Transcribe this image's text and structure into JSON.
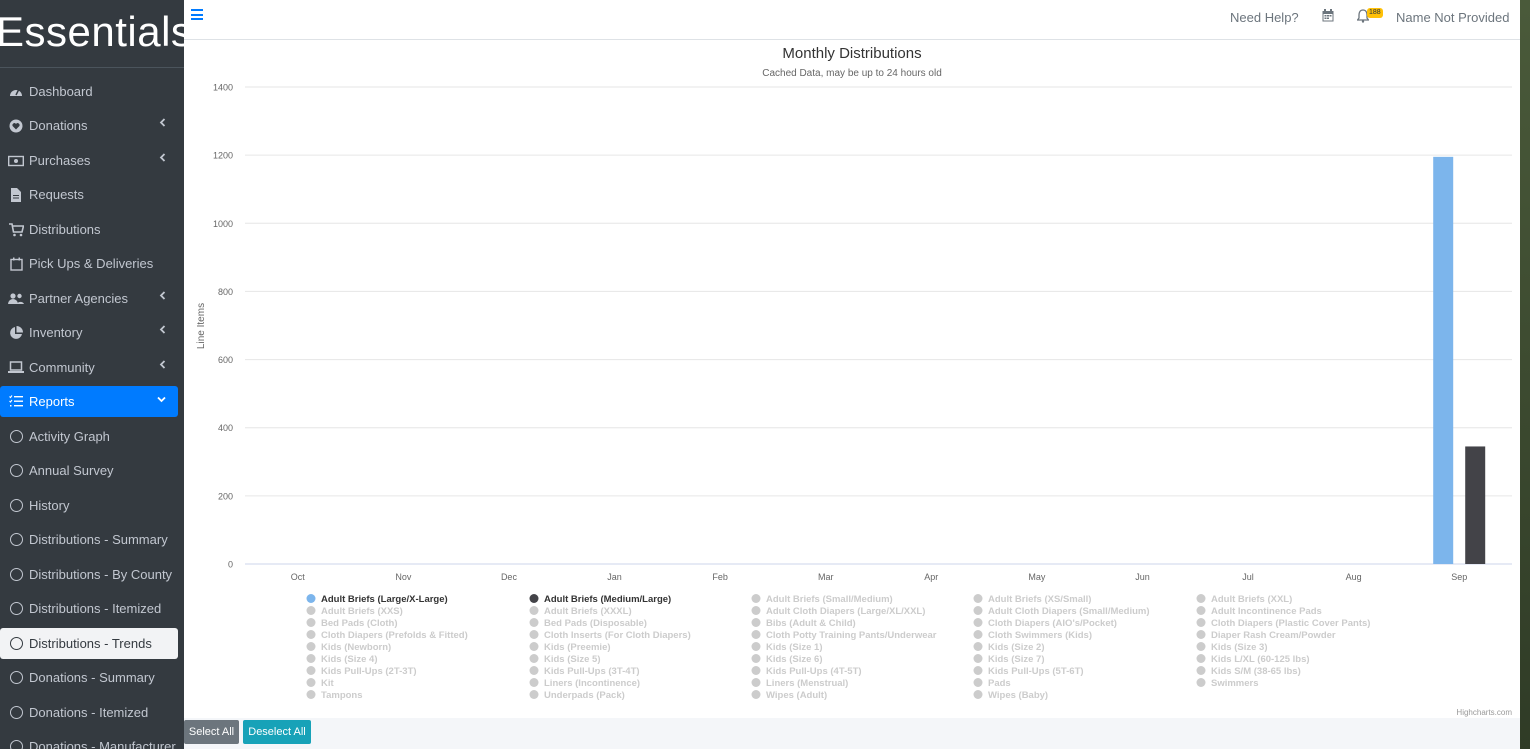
{
  "brand": "Essentials",
  "sidebar": {
    "items": [
      {
        "label": "Dashboard",
        "icon": "dashboard-icon",
        "chevron": false
      },
      {
        "label": "Donations",
        "icon": "heart-icon",
        "chevron": true
      },
      {
        "label": "Purchases",
        "icon": "money-icon",
        "chevron": true
      },
      {
        "label": "Requests",
        "icon": "file-icon",
        "chevron": false
      },
      {
        "label": "Distributions",
        "icon": "cart-icon",
        "chevron": false
      },
      {
        "label": "Pick Ups & Deliveries",
        "icon": "calendar-icon",
        "chevron": false
      },
      {
        "label": "Partner Agencies",
        "icon": "users-icon",
        "chevron": true
      },
      {
        "label": "Inventory",
        "icon": "pie-icon",
        "chevron": true
      },
      {
        "label": "Community",
        "icon": "laptop-icon",
        "chevron": true
      },
      {
        "label": "Reports",
        "icon": "list-icon",
        "chevron": true,
        "active": true
      },
      {
        "label": "Activity Graph",
        "icon": "circle-icon"
      },
      {
        "label": "Annual Survey",
        "icon": "circle-icon"
      },
      {
        "label": "History",
        "icon": "circle-icon"
      },
      {
        "label": "Distributions - Summary",
        "icon": "circle-icon"
      },
      {
        "label": "Distributions - By County",
        "icon": "circle-icon"
      },
      {
        "label": "Distributions - Itemized",
        "icon": "circle-icon"
      },
      {
        "label": "Distributions - Trends",
        "icon": "circle-icon",
        "current": true
      },
      {
        "label": "Donations - Summary",
        "icon": "circle-icon"
      },
      {
        "label": "Donations - Itemized",
        "icon": "circle-icon"
      },
      {
        "label": "Donations - Manufacturer",
        "icon": "circle-icon"
      }
    ]
  },
  "topbar": {
    "need_help": "Need Help?",
    "notification_count": "188",
    "user_name": "Name Not Provided"
  },
  "buttons": {
    "select_all": "Select All",
    "deselect_all": "Deselect All"
  },
  "chart_data": {
    "type": "bar",
    "title": "Monthly Distributions",
    "subtitle": "Cached Data, may be up to 24 hours old",
    "ylabel": "Line Items",
    "ylim": [
      0,
      1400
    ],
    "yticks": [
      0,
      200,
      400,
      600,
      800,
      1000,
      1200,
      1400
    ],
    "categories": [
      "Oct",
      "Nov",
      "Dec",
      "Jan",
      "Feb",
      "Mar",
      "Apr",
      "May",
      "Jun",
      "Jul",
      "Aug",
      "Sep"
    ],
    "series": [
      {
        "name": "Adult Briefs (Large/X-Large)",
        "color": "#7cb5ec",
        "values": [
          0,
          0,
          0,
          0,
          0,
          0,
          0,
          0,
          0,
          0,
          0,
          1195
        ]
      },
      {
        "name": "Adult Briefs (Medium/Large)",
        "color": "#434348",
        "values": [
          0,
          0,
          0,
          0,
          0,
          0,
          0,
          0,
          0,
          0,
          0,
          345
        ]
      }
    ],
    "legend_items": [
      "Adult Briefs (Large/X-Large)",
      "Adult Briefs (Medium/Large)",
      "Adult Briefs (Small/Medium)",
      "Adult Briefs (XS/Small)",
      "Adult Briefs (XXL)",
      "Adult Briefs (XXS)",
      "Adult Briefs (XXXL)",
      "Adult Cloth Diapers (Large/XL/XXL)",
      "Adult Cloth Diapers (Small/Medium)",
      "Adult Incontinence Pads",
      "Bed Pads (Cloth)",
      "Bed Pads (Disposable)",
      "Bibs (Adult & Child)",
      "Cloth Diapers (AIO's/Pocket)",
      "Cloth Diapers (Plastic Cover Pants)",
      "Cloth Diapers (Prefolds & Fitted)",
      "Cloth Inserts (For Cloth Diapers)",
      "Cloth Potty Training Pants/Underwear",
      "Cloth Swimmers (Kids)",
      "Diaper Rash Cream/Powder",
      "Kids (Newborn)",
      "Kids (Preemie)",
      "Kids (Size 1)",
      "Kids (Size 2)",
      "Kids (Size 3)",
      "Kids (Size 4)",
      "Kids (Size 5)",
      "Kids (Size 6)",
      "Kids (Size 7)",
      "Kids L/XL (60-125 lbs)",
      "Kids Pull-Ups (2T-3T)",
      "Kids Pull-Ups (3T-4T)",
      "Kids Pull-Ups (4T-5T)",
      "Kids Pull-Ups (5T-6T)",
      "Kids S/M (38-65 lbs)",
      "Kit",
      "Liners (Incontinence)",
      "Liners (Menstrual)",
      "Pads",
      "Swimmers",
      "Tampons",
      "Underpads (Pack)",
      "Wipes (Adult)",
      "Wipes (Baby)"
    ],
    "legend_active_count": 2,
    "legend_placement": "bottom",
    "credits": "Highcharts.com",
    "grid": true
  }
}
